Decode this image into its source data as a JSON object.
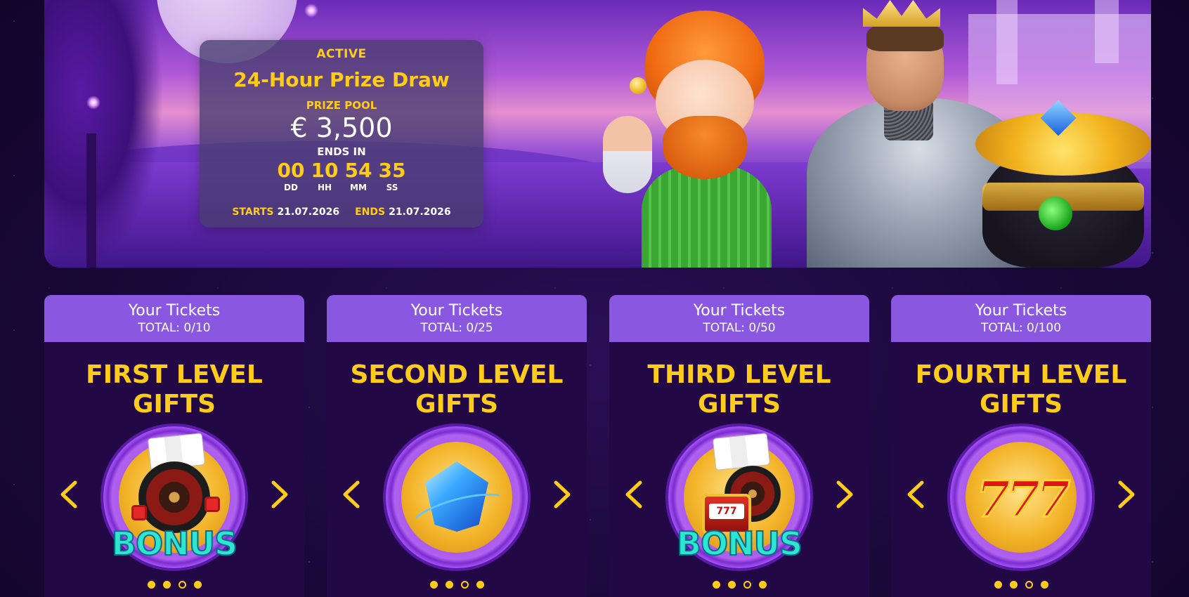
{
  "promo": {
    "status": "ACTIVE",
    "title": "24-Hour Prize Draw",
    "prize_pool_label": "PRIZE POOL",
    "prize_pool_value": "€ 3,500",
    "ends_in_label": "ENDS IN",
    "countdown": [
      {
        "value": "00",
        "label": "DD"
      },
      {
        "value": "10",
        "label": "HH"
      },
      {
        "value": "54",
        "label": "MM"
      },
      {
        "value": "35",
        "label": "SS"
      }
    ],
    "starts_label": "STARTS",
    "starts_date": "21.07.2026",
    "ends_label": "ENDS",
    "ends_date": "21.07.2026"
  },
  "cards": [
    {
      "ticket_title": "Your Tickets",
      "ticket_total": "TOTAL: 0/10",
      "level_line1": "FIRST LEVEL",
      "level_line2": "GIFTS",
      "image": "bonus-roulette-icon",
      "active_dot": 0
    },
    {
      "ticket_title": "Your Tickets",
      "ticket_total": "TOTAL: 0/25",
      "level_line1": "SECOND LEVEL",
      "level_line2": "GIFTS",
      "image": "blue-gem-icon",
      "active_dot": 0
    },
    {
      "ticket_title": "Your Tickets",
      "ticket_total": "TOTAL: 0/50",
      "level_line1": "THIRD LEVEL",
      "level_line2": "GIFTS",
      "image": "bonus-slot-icon",
      "active_dot": 0
    },
    {
      "ticket_title": "Your Tickets",
      "ticket_total": "TOTAL: 0/100",
      "level_line1": "FOURTH LEVEL",
      "level_line2": "GIFTS",
      "image": "lucky-777-icon",
      "active_dot": 0
    }
  ],
  "bonus_word": "BONUS",
  "sevens_word": "777",
  "colors": {
    "accent_yellow": "#ffcc1a",
    "card_header": "#8a58e0",
    "card_body": "#220946",
    "page_background": "#1a0838"
  },
  "icons": {
    "prev": "chevron-left-icon",
    "next": "chevron-right-icon"
  }
}
